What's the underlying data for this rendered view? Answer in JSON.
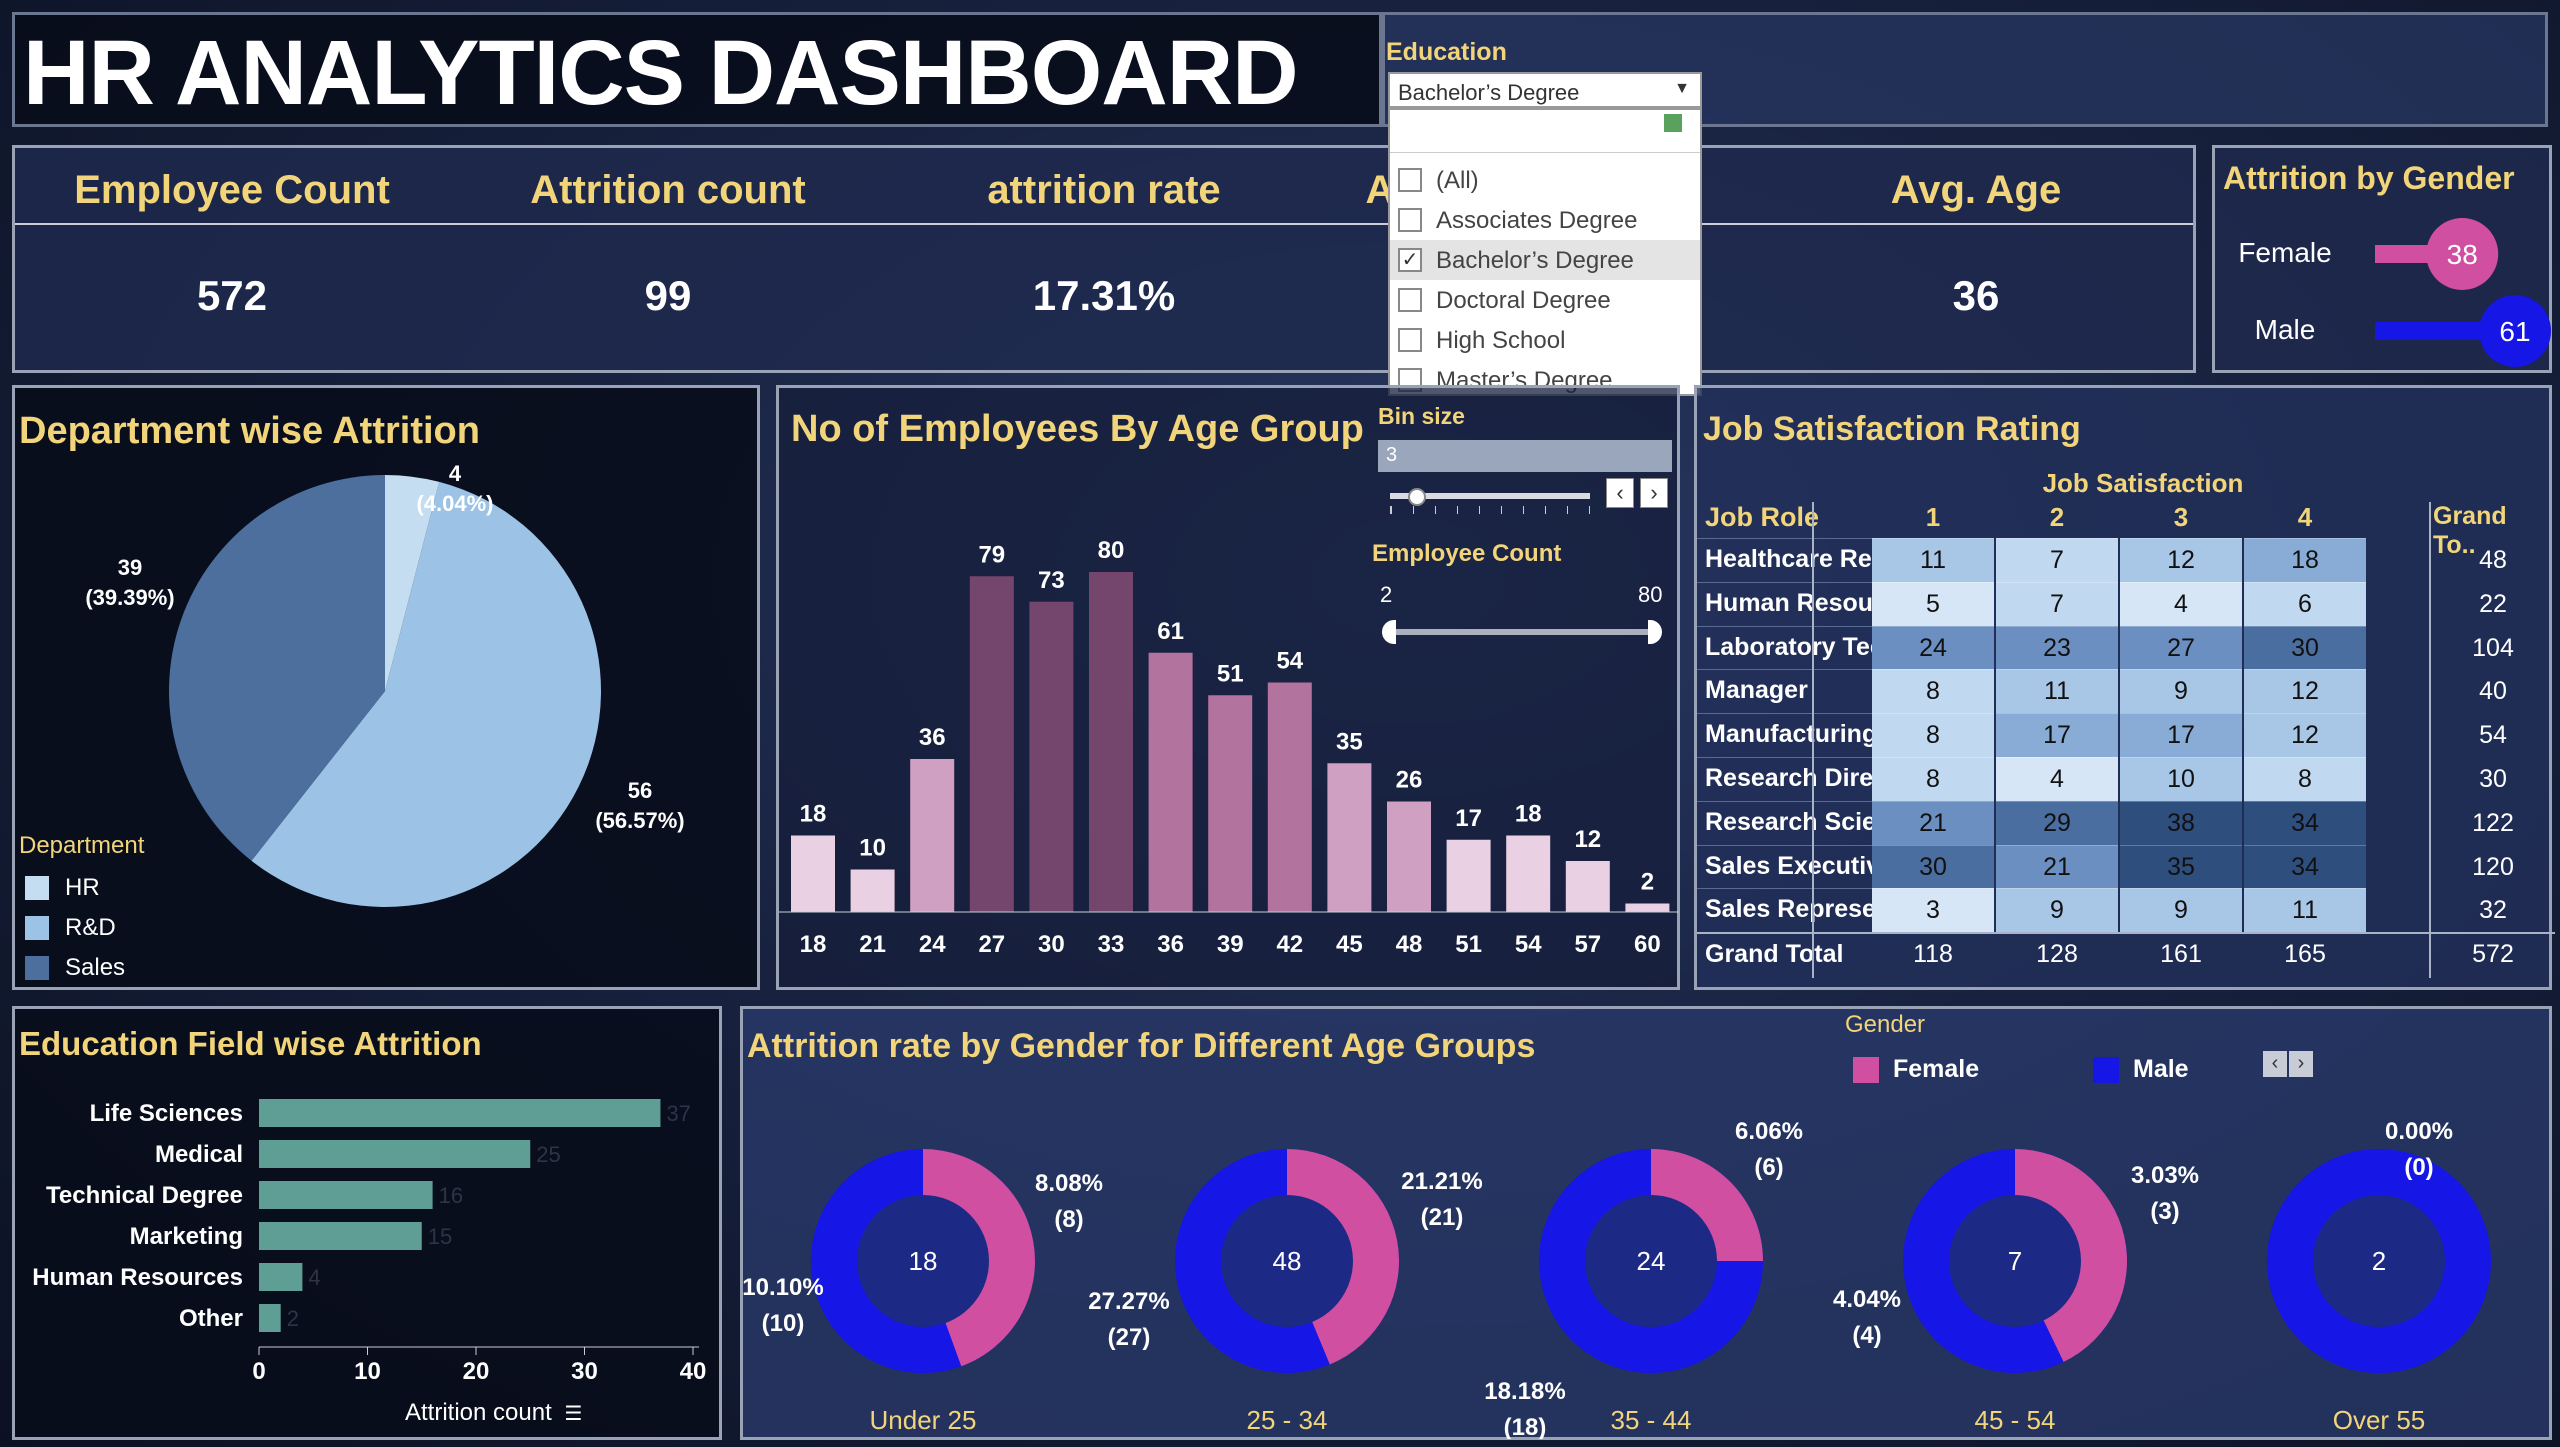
{
  "title": "HR ANALYTICS DASHBOARD",
  "filter": {
    "label": "Education",
    "selected": "Bachelor’s Degree",
    "options": [
      "(All)",
      "Associates Degree",
      "Bachelor’s Degree",
      "Doctoral Degree",
      "High School",
      "Master’s Degree"
    ],
    "checked_index": 2
  },
  "kpis": [
    {
      "label": "Employee Count",
      "value": "572"
    },
    {
      "label": "Attrition count",
      "value": "99"
    },
    {
      "label": "attrition rate",
      "value": "17.31%"
    },
    {
      "label": "A",
      "value": ""
    },
    {
      "label": "Avg. Age",
      "value": "36"
    }
  ],
  "attrition_by_gender": {
    "title": "Attrition by Gender",
    "rows": [
      {
        "label": "Female",
        "value": 38,
        "color": "#d14fa0"
      },
      {
        "label": "Male",
        "value": 61,
        "color": "#1616e6"
      }
    ]
  },
  "bin_size": {
    "label": "Bin size",
    "value": "3"
  },
  "employee_count_range": {
    "label": "Employee Count",
    "min": "2",
    "max": "80"
  },
  "dept_chart": {
    "title": "Department wise Attrition",
    "legend_title": "Department",
    "chart_data": {
      "type": "pie",
      "categories": [
        "HR",
        "R&D",
        "Sales"
      ],
      "values": [
        4,
        56,
        39
      ],
      "labels": [
        "4",
        "56",
        "39"
      ],
      "pct_labels": [
        "(4.04%)",
        "(56.57%)",
        "(39.39%)"
      ],
      "colors": [
        "#c5ddf0",
        "#9cc3e6",
        "#4d6f9e"
      ]
    }
  },
  "age_chart": {
    "title": "No of Employees By Age Group",
    "chart_data": {
      "type": "bar",
      "categories": [
        "18",
        "21",
        "24",
        "27",
        "30",
        "33",
        "36",
        "39",
        "42",
        "45",
        "48",
        "51",
        "54",
        "57",
        "60"
      ],
      "values": [
        18,
        10,
        36,
        79,
        73,
        80,
        61,
        51,
        54,
        35,
        26,
        17,
        18,
        12,
        2
      ]
    }
  },
  "job_satisfaction": {
    "title": "Job Satisfaction Rating",
    "col_group": "Job Satisfaction",
    "row_header": "Job Role",
    "columns": [
      "1",
      "2",
      "3",
      "4"
    ],
    "total_header": "Grand To..",
    "rows": [
      {
        "role": "Healthcare Repres..",
        "vals": [
          "11",
          "7",
          "12",
          "18"
        ],
        "total": "48"
      },
      {
        "role": "Human Resources",
        "vals": [
          "5",
          "7",
          "4",
          "6"
        ],
        "total": "22"
      },
      {
        "role": "Laboratory Techni..",
        "vals": [
          "24",
          "23",
          "27",
          "30"
        ],
        "total": "104"
      },
      {
        "role": "Manager",
        "vals": [
          "8",
          "11",
          "9",
          "12"
        ],
        "total": "40"
      },
      {
        "role": "Manufacturing Dir..",
        "vals": [
          "8",
          "17",
          "17",
          "12"
        ],
        "total": "54"
      },
      {
        "role": "Research Director",
        "vals": [
          "8",
          "4",
          "10",
          "8"
        ],
        "total": "30"
      },
      {
        "role": "Research Scientist",
        "vals": [
          "21",
          "29",
          "38",
          "34"
        ],
        "total": "122"
      },
      {
        "role": "Sales Executive",
        "vals": [
          "30",
          "21",
          "35",
          "34"
        ],
        "total": "120"
      },
      {
        "role": "Sales Representati..",
        "vals": [
          "3",
          "9",
          "9",
          "11"
        ],
        "total": "32"
      }
    ],
    "grand_total": {
      "label": "Grand Total",
      "vals": [
        "118",
        "128",
        "161",
        "165"
      ],
      "total": "572"
    }
  },
  "edu_field": {
    "title": "Education Field wise Attrition",
    "xlabel": "Attrition count",
    "chart_data": {
      "type": "bar",
      "orientation": "horizontal",
      "categories": [
        "Life Sciences",
        "Medical",
        "Technical Degree",
        "Marketing",
        "Human Resources",
        "Other"
      ],
      "values": [
        37,
        25,
        16,
        15,
        4,
        2
      ],
      "xlim": [
        0,
        40
      ],
      "ticks": [
        "0",
        "10",
        "20",
        "30",
        "40"
      ],
      "color": "#5f9e94"
    }
  },
  "gender_age": {
    "title": "Attrition rate by Gender for Different Age Groups",
    "legend_title": "Gender",
    "legend": [
      {
        "label": "Female",
        "color": "#d14fa0"
      },
      {
        "label": "Male",
        "color": "#1616e6"
      }
    ],
    "chart_data": {
      "type": "pie",
      "groups": [
        {
          "name": "Under 25",
          "center": "18",
          "female": 8,
          "male": 10,
          "female_label": "8.08%",
          "female_count": "(8)",
          "male_label": "10.10%",
          "male_count": "(10)"
        },
        {
          "name": "25 - 34",
          "center": "48",
          "female": 21,
          "male": 27,
          "female_label": "21.21%",
          "female_count": "(21)",
          "male_label": "27.27%",
          "male_count": "(27)"
        },
        {
          "name": "35 - 44",
          "center": "24",
          "female": 6,
          "male": 18,
          "female_label": "6.06%",
          "female_count": "(6)",
          "male_label": "18.18%",
          "male_count": "(18)"
        },
        {
          "name": "45 - 54",
          "center": "7",
          "female": 3,
          "male": 4,
          "female_label": "3.03%",
          "female_count": "(3)",
          "male_label": "4.04%",
          "male_count": "(4)"
        },
        {
          "name": "Over 55",
          "center": "2",
          "female": 0,
          "male": 2,
          "female_label": "0.00%",
          "female_count": "(0)",
          "male_label": "",
          "male_count": ""
        }
      ]
    }
  }
}
